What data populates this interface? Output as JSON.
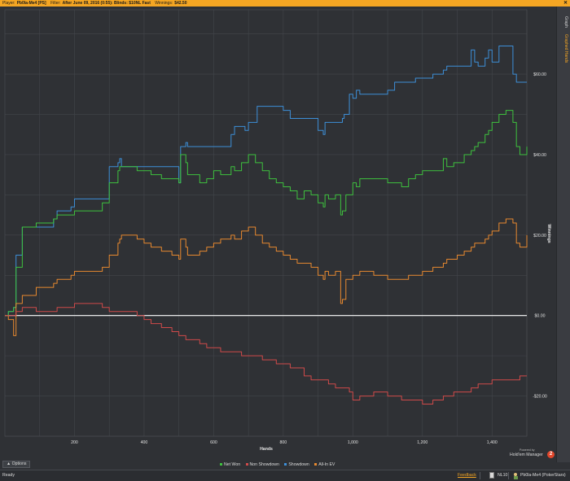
{
  "filter_bar": {
    "player_label": "Player:",
    "player_value": "Pb0la-Me4 [PS]",
    "filter_label": "Filter:",
    "filter_value": "After June 09, 2016 (0:55): Blinds: $10NL Fast",
    "winnings_label": "Winnings:",
    "winnings_value": "$42.50",
    "close_glyph": "✕"
  },
  "side_tabs": {
    "graph": "Graph",
    "graphed_hands": "Graphed Hands"
  },
  "legend": [
    {
      "label": "Net Won",
      "color": "#3ec23e"
    },
    {
      "label": "Non Showdown",
      "color": "#d04a4a"
    },
    {
      "label": "Showdown",
      "color": "#3d8fd8"
    },
    {
      "label": "All-In EV",
      "color": "#e8892f"
    }
  ],
  "options_button": "Options",
  "branding": {
    "powered_by": "Powered by",
    "name": "Hold'em Manager",
    "badge": "2"
  },
  "status_bar": {
    "status": "Ready",
    "feedback": "Feedback",
    "stake": "NL10",
    "player": "Pb0la-Me4 (PokerStars)"
  },
  "colors": {
    "accent": "#f5a623",
    "background": "#2f3135",
    "zero_line": "#ffffff"
  },
  "chart_data": {
    "type": "line",
    "xlabel": "Hands",
    "ylabel": "Winnings",
    "xlim": [
      0,
      1500
    ],
    "ylim": [
      -30,
      76
    ],
    "x_ticks": [
      200,
      400,
      600,
      800,
      1000,
      1200,
      1400
    ],
    "x_tick_labels": [
      "200",
      "400",
      "600",
      "800",
      "1,000",
      "1,200",
      "1,400"
    ],
    "y_ticks": [
      -20,
      0,
      20,
      40,
      60
    ],
    "y_tick_labels": [
      "-$20.00",
      "$0.00",
      "$20.00",
      "$40.00",
      "$60.00"
    ],
    "grid": true,
    "legend_position": "bottom",
    "series": [
      {
        "name": "Showdown",
        "x": [
          0,
          10,
          25,
          32,
          50,
          90,
          140,
          150,
          190,
          200,
          280,
          300,
          325,
          330,
          335,
          480,
          500,
          505,
          520,
          525,
          650,
          660,
          680,
          690,
          700,
          720,
          725,
          800,
          820,
          900,
          915,
          920,
          930,
          970,
          975,
          980,
          990,
          1000,
          1010,
          1020,
          1100,
          1120,
          1180,
          1200,
          1230,
          1260,
          1270,
          1300,
          1340,
          1350,
          1360,
          1380,
          1390,
          1400,
          1420,
          1440,
          1460,
          1470,
          1480,
          1500
        ],
        "y": [
          0,
          1,
          2,
          15,
          22,
          22,
          24,
          26,
          27,
          29,
          29,
          37,
          38,
          39,
          37,
          37,
          33,
          42,
          43,
          42,
          45,
          47,
          47,
          46,
          48,
          48,
          52,
          51,
          49,
          46,
          45,
          48,
          48,
          49,
          50,
          50,
          55,
          54,
          56,
          55,
          56,
          58,
          59,
          59,
          60,
          61,
          62,
          62,
          66,
          63,
          62,
          64,
          66,
          63,
          67,
          67,
          60,
          58,
          58,
          58
        ]
      },
      {
        "name": "Net Won",
        "x": [
          0,
          10,
          25,
          32,
          50,
          90,
          140,
          150,
          190,
          200,
          280,
          300,
          325,
          330,
          335,
          380,
          400,
          420,
          450,
          480,
          500,
          505,
          520,
          525,
          560,
          580,
          600,
          620,
          650,
          660,
          680,
          700,
          720,
          740,
          760,
          780,
          800,
          820,
          840,
          860,
          880,
          900,
          915,
          920,
          930,
          950,
          965,
          970,
          980,
          990,
          1000,
          1010,
          1020,
          1060,
          1100,
          1120,
          1140,
          1160,
          1180,
          1200,
          1230,
          1260,
          1270,
          1290,
          1300,
          1320,
          1340,
          1350,
          1360,
          1380,
          1390,
          1400,
          1420,
          1440,
          1460,
          1470,
          1480,
          1500
        ],
        "y": [
          0,
          1,
          2,
          12,
          22,
          23,
          24,
          25,
          25,
          26,
          28,
          33,
          36,
          37,
          37,
          36,
          36,
          35,
          34,
          34,
          33,
          40,
          38,
          35,
          33,
          34,
          36,
          35,
          37,
          36,
          38,
          40,
          38,
          36,
          34,
          33,
          32,
          31,
          29,
          31,
          30,
          28,
          27,
          30,
          29,
          30,
          25,
          26,
          30,
          30,
          33,
          32,
          34,
          34,
          33,
          33,
          32,
          34,
          35,
          36,
          36,
          39,
          37,
          38,
          38,
          40,
          41,
          42,
          43,
          45,
          46,
          48,
          50,
          51,
          48,
          42,
          40,
          42
        ]
      },
      {
        "name": "All-In EV",
        "x": [
          0,
          10,
          25,
          32,
          50,
          90,
          140,
          150,
          190,
          200,
          280,
          300,
          325,
          330,
          335,
          380,
          400,
          420,
          450,
          480,
          500,
          505,
          520,
          525,
          560,
          580,
          600,
          620,
          650,
          660,
          680,
          700,
          720,
          740,
          760,
          780,
          800,
          820,
          840,
          860,
          880,
          900,
          915,
          920,
          930,
          950,
          965,
          970,
          980,
          990,
          1000,
          1010,
          1020,
          1060,
          1100,
          1120,
          1140,
          1160,
          1180,
          1200,
          1230,
          1260,
          1270,
          1290,
          1300,
          1320,
          1340,
          1350,
          1360,
          1380,
          1390,
          1400,
          1420,
          1440,
          1460,
          1470,
          1480,
          1500
        ],
        "y": [
          0,
          -1,
          -5,
          3,
          5,
          7,
          8,
          9,
          10,
          11,
          12,
          15,
          18,
          19,
          20,
          19,
          18,
          17,
          16,
          15,
          14,
          19,
          17,
          15,
          16,
          17,
          18,
          19,
          20,
          19,
          21,
          22,
          20,
          18,
          17,
          16,
          15,
          14,
          13,
          13,
          12,
          10,
          9,
          11,
          10,
          11,
          3,
          4,
          9,
          9,
          10,
          10,
          11,
          10,
          9,
          9,
          9,
          10,
          10,
          11,
          12,
          13,
          14,
          14,
          15,
          16,
          17,
          18,
          18,
          19,
          20,
          21,
          23,
          24,
          23,
          18,
          17,
          20
        ]
      },
      {
        "name": "Non Showdown",
        "x": [
          0,
          10,
          25,
          32,
          50,
          90,
          140,
          150,
          190,
          200,
          240,
          280,
          300,
          325,
          335,
          380,
          400,
          420,
          450,
          480,
          500,
          520,
          560,
          580,
          600,
          620,
          650,
          680,
          700,
          740,
          780,
          800,
          820,
          860,
          880,
          900,
          930,
          950,
          990,
          1000,
          1020,
          1060,
          1100,
          1140,
          1180,
          1200,
          1230,
          1260,
          1290,
          1300,
          1340,
          1360,
          1400,
          1440,
          1480,
          1500
        ],
        "y": [
          0,
          0,
          0,
          1,
          2,
          1,
          1,
          2,
          2,
          3,
          3,
          2,
          1,
          1,
          1,
          0,
          -1,
          -2,
          -3,
          -4,
          -5,
          -6,
          -7,
          -8,
          -8,
          -9,
          -9,
          -10,
          -10,
          -11,
          -12,
          -12,
          -13,
          -15,
          -16,
          -16,
          -17,
          -18,
          -19,
          -21,
          -20,
          -19,
          -20,
          -21,
          -21,
          -22,
          -21,
          -20,
          -19,
          -19,
          -18,
          -17,
          -16,
          -16,
          -15,
          -15
        ]
      }
    ]
  }
}
